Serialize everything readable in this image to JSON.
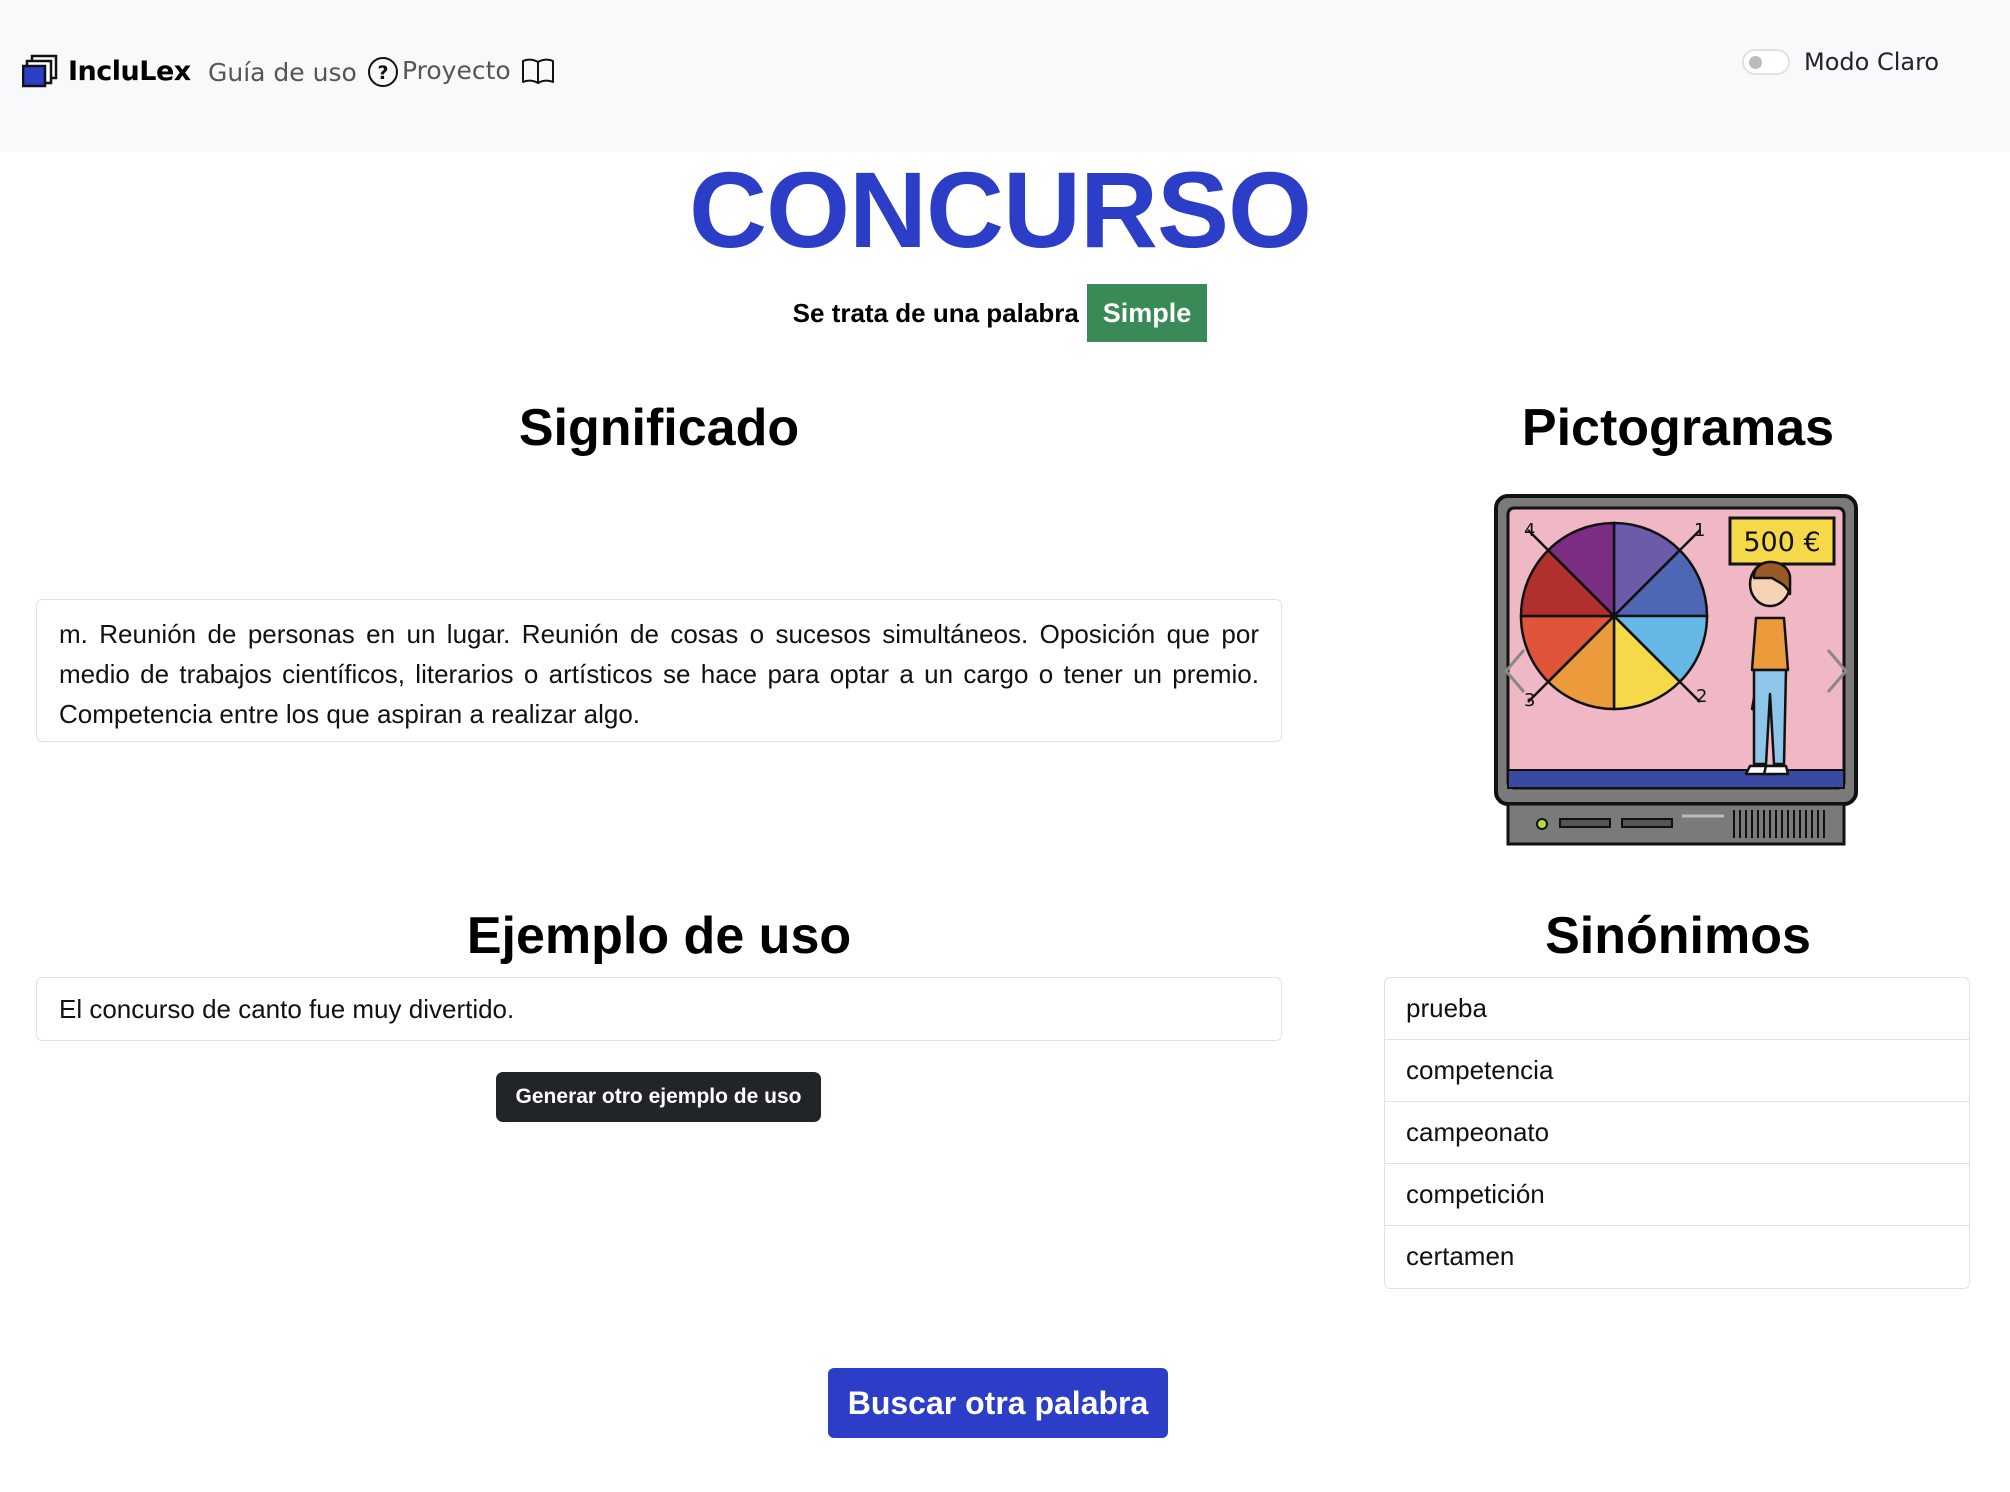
{
  "navbar": {
    "brand": "IncluLex",
    "guide_label": "Guía de uso",
    "project_label": "Proyecto",
    "mode_label": "Modo Claro",
    "mode_on": false
  },
  "word": {
    "title": "CONCURSO",
    "type_prefix": "Se trata de una palabra",
    "type_badge": "Simple",
    "badge_color": "#3a8a57",
    "title_color": "#2c3dc8"
  },
  "sections": {
    "meaning_heading": "Significado",
    "pictograms_heading": "Pictogramas",
    "example_heading": "Ejemplo de uso",
    "synonyms_heading": "Sinónimos"
  },
  "definition": "m. Reunión de personas en un lugar. Reunión de cosas o sucesos simultáneos. Oposición que por medio de trabajos científicos, literarios o artísticos se hace para optar a un cargo o tener un premio. Competencia entre los que aspiran a realizar algo.",
  "pictogram": {
    "description_icon": "tv-game-show-pictogram",
    "price_label": "500 €",
    "wheel_numbers": [
      "1",
      "2",
      "3",
      "4"
    ]
  },
  "example": {
    "sentence": "El concurso de canto fue muy divertido.",
    "generate_button": "Generar otro ejemplo de uso"
  },
  "synonyms": [
    "prueba",
    "competencia",
    "campeonato",
    "competición",
    "certamen"
  ],
  "search_button": "Buscar otra palabra"
}
